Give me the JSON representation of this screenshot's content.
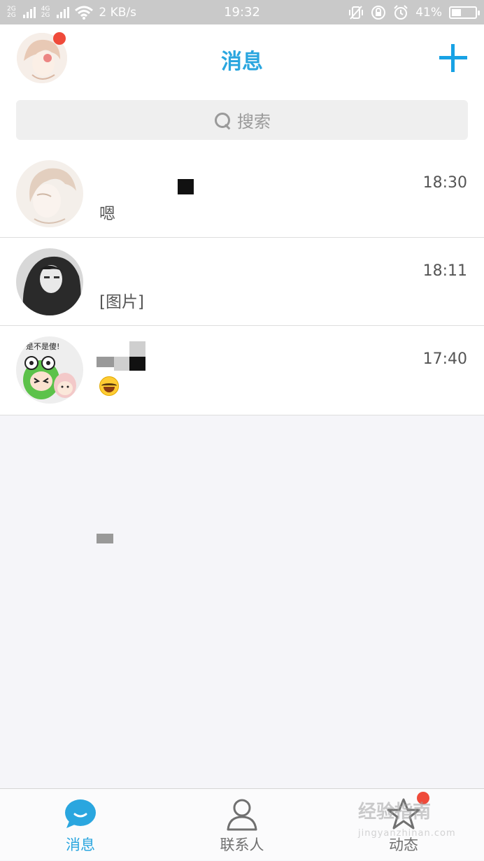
{
  "status_bar": {
    "network_top": "2G",
    "network_mid": "4G",
    "network_bottom": "2G",
    "speed": "2 KB/s",
    "time": "19:32",
    "battery_text": "41%",
    "battery_level": 0.41
  },
  "header": {
    "title": "消息",
    "has_notification": true
  },
  "search": {
    "placeholder": "搜索"
  },
  "conversations": [
    {
      "name": "",
      "time": "18:30",
      "preview": "嗯"
    },
    {
      "name": "",
      "time": "18:11",
      "preview": "[图片]"
    },
    {
      "name": "",
      "time": "17:40",
      "preview": "",
      "preview_emoji": "laughing-tears-emoji"
    }
  ],
  "avatar_text": {
    "frog_caption": "是不是傻!"
  },
  "tabs": [
    {
      "label": "消息",
      "icon": "chat-bubble-icon",
      "active": true
    },
    {
      "label": "联系人",
      "icon": "person-icon",
      "active": false
    },
    {
      "label": "动态",
      "icon": "star-icon",
      "active": false,
      "badge": true
    }
  ],
  "watermark": {
    "text": "经验指南",
    "sub": "jingyanzhinan.com"
  },
  "colors": {
    "accent": "#2aa6df",
    "badge": "#ef4a3a",
    "status_bar": "#c9c9c9",
    "background": "#f5f5f9"
  }
}
